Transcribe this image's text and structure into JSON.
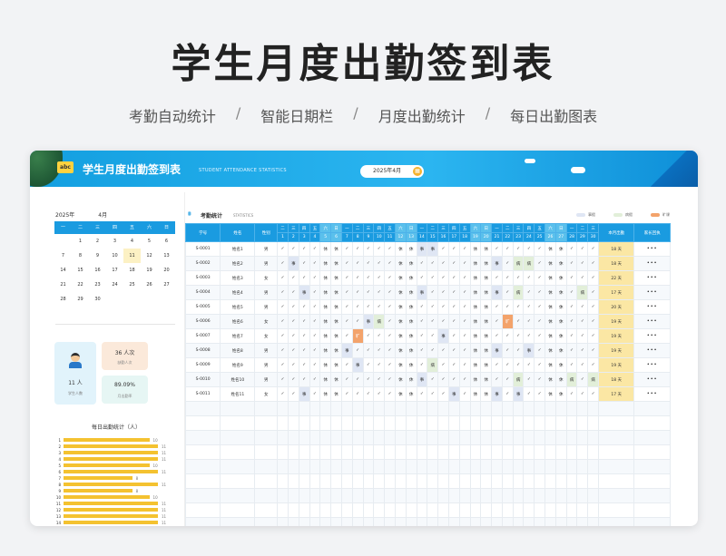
{
  "hero": {
    "title": "学生月度出勤签到表",
    "features": [
      "考勤自动统计",
      "智能日期栏",
      "月度出勤统计",
      "每日出勤图表"
    ],
    "separator": "/"
  },
  "banner": {
    "logo_text": "abc",
    "title": "学生月度出勤签到表",
    "subtitle": "STUDENT ATTENDANCE STATISTICS",
    "month_picker": "2025年4月",
    "calendar_icon": "calendar-icon"
  },
  "calendar": {
    "year": "2025年",
    "month": "4月",
    "weekdays": [
      "一",
      "二",
      "三",
      "四",
      "五",
      "六",
      "日"
    ],
    "today": "11",
    "weeks": [
      [
        "",
        "1",
        "2",
        "3",
        "4",
        "5",
        "6"
      ],
      [
        "7",
        "8",
        "9",
        "10",
        "11",
        "12",
        "13"
      ],
      [
        "14",
        "15",
        "16",
        "17",
        "18",
        "19",
        "20"
      ],
      [
        "21",
        "22",
        "23",
        "24",
        "25",
        "26",
        "27"
      ],
      [
        "28",
        "29",
        "30",
        "",
        "",
        "",
        ""
      ]
    ]
  },
  "cards": {
    "students": {
      "value": "11 人",
      "label": "学生人数"
    },
    "absent": {
      "value": "36 人次",
      "label": "缺勤人次"
    },
    "rate": {
      "value": "89.09%",
      "label": "月出勤率"
    }
  },
  "daily": {
    "title": "每日出勤统计（人）",
    "max": 11,
    "days": [
      {
        "d": "1",
        "v": 10
      },
      {
        "d": "2",
        "v": 11
      },
      {
        "d": "3",
        "v": 11
      },
      {
        "d": "4",
        "v": 11
      },
      {
        "d": "5",
        "v": 10
      },
      {
        "d": "6",
        "v": 11
      },
      {
        "d": "7",
        "v": 8
      },
      {
        "d": "8",
        "v": 11
      },
      {
        "d": "9",
        "v": 8
      },
      {
        "d": "10",
        "v": 10
      },
      {
        "d": "11",
        "v": 11
      },
      {
        "d": "12",
        "v": 11
      },
      {
        "d": "13",
        "v": 11
      },
      {
        "d": "14",
        "v": 11
      }
    ]
  },
  "stats": {
    "title": "考勤统计",
    "subtitle": "STATISTICS",
    "legend": [
      {
        "label": "事假",
        "color": "#dfe6f4"
      },
      {
        "label": "病假",
        "color": "#e2efd9"
      },
      {
        "label": "旷课",
        "color": "#f3a36b"
      }
    ]
  },
  "table": {
    "col_id": "学号",
    "col_name": "姓名",
    "col_gender": "性别",
    "col_total": "本月出勤",
    "col_parent": "家长回执",
    "weekday_row": [
      "二",
      "三",
      "四",
      "五",
      "六",
      "日",
      "一",
      "二",
      "三",
      "四",
      "五",
      "六",
      "日",
      "一",
      "二",
      "三",
      "四",
      "五",
      "六",
      "日",
      "一",
      "二",
      "三",
      "四",
      "五",
      "六",
      "日",
      "一",
      "二",
      "三"
    ],
    "weekend_index": [
      4,
      5,
      11,
      12,
      18,
      19,
      25,
      26
    ],
    "days": [
      "1",
      "2",
      "3",
      "4",
      "5",
      "6",
      "7",
      "8",
      "9",
      "10",
      "11",
      "12",
      "13",
      "14",
      "15",
      "16",
      "17",
      "18",
      "19",
      "20",
      "21",
      "22",
      "23",
      "24",
      "25",
      "26",
      "27",
      "28",
      "29",
      "30"
    ],
    "more": "•••",
    "rows": [
      {
        "id": "S-0001",
        "name": "姓名1",
        "gender": "男",
        "marks": [
          "✓",
          "✓",
          "✓",
          "✓",
          "休",
          "休",
          "✓",
          "✓",
          "✓",
          "✓",
          "✓",
          "休",
          "休",
          "事",
          "事",
          "✓",
          "✓",
          "✓",
          "休",
          "休",
          "✓",
          "✓",
          "✓",
          "✓",
          "✓",
          "休",
          "休",
          "✓",
          "✓",
          "✓"
        ],
        "total": "18 天"
      },
      {
        "id": "S-0002",
        "name": "姓名2",
        "gender": "男",
        "marks": [
          "✓",
          "事",
          "✓",
          "✓",
          "休",
          "休",
          "✓",
          "✓",
          "✓",
          "✓",
          "✓",
          "休",
          "休",
          "✓",
          "✓",
          "✓",
          "✓",
          "✓",
          "休",
          "休",
          "事",
          "✓",
          "病",
          "病",
          "✓",
          "休",
          "休",
          "✓",
          "✓",
          "✓"
        ],
        "total": "18 天"
      },
      {
        "id": "S-0003",
        "name": "姓名3",
        "gender": "女",
        "marks": [
          "✓",
          "✓",
          "✓",
          "✓",
          "休",
          "休",
          "✓",
          "✓",
          "✓",
          "✓",
          "✓",
          "休",
          "休",
          "✓",
          "✓",
          "✓",
          "✓",
          "✓",
          "休",
          "休",
          "✓",
          "✓",
          "✓",
          "✓",
          "✓",
          "休",
          "休",
          "✓",
          "✓",
          "✓"
        ],
        "total": "22 天"
      },
      {
        "id": "S-0004",
        "name": "姓名4",
        "gender": "男",
        "marks": [
          "✓",
          "✓",
          "事",
          "✓",
          "休",
          "休",
          "✓",
          "✓",
          "✓",
          "✓",
          "✓",
          "休",
          "休",
          "事",
          "✓",
          "✓",
          "✓",
          "✓",
          "休",
          "休",
          "事",
          "✓",
          "病",
          "✓",
          "✓",
          "休",
          "休",
          "✓",
          "病",
          "✓"
        ],
        "total": "17 天"
      },
      {
        "id": "S-0005",
        "name": "姓名5",
        "gender": "男",
        "marks": [
          "✓",
          "✓",
          "✓",
          "✓",
          "休",
          "休",
          "✓",
          "✓",
          "✓",
          "✓",
          "✓",
          "休",
          "休",
          "✓",
          "✓",
          "✓",
          "✓",
          "✓",
          "休",
          "休",
          "✓",
          "✓",
          "✓",
          "✓",
          "✓",
          "休",
          "休",
          "✓",
          "✓",
          "✓"
        ],
        "total": "20 天"
      },
      {
        "id": "S-0006",
        "name": "姓名6",
        "gender": "女",
        "marks": [
          "✓",
          "✓",
          "✓",
          "✓",
          "休",
          "休",
          "✓",
          "✓",
          "事",
          "病",
          "✓",
          "休",
          "休",
          "✓",
          "✓",
          "✓",
          "✓",
          "✓",
          "休",
          "休",
          "✓",
          "旷",
          "✓",
          "✓",
          "✓",
          "休",
          "休",
          "✓",
          "✓",
          "✓"
        ],
        "total": "19 天"
      },
      {
        "id": "S-0007",
        "name": "姓名7",
        "gender": "女",
        "marks": [
          "✓",
          "✓",
          "✓",
          "✓",
          "休",
          "休",
          "✓",
          "旷",
          "✓",
          "✓",
          "✓",
          "休",
          "休",
          "✓",
          "✓",
          "事",
          "✓",
          "✓",
          "休",
          "休",
          "✓",
          "✓",
          "✓",
          "✓",
          "✓",
          "休",
          "休",
          "✓",
          "✓",
          "✓"
        ],
        "total": "19 天"
      },
      {
        "id": "S-0008",
        "name": "姓名8",
        "gender": "男",
        "marks": [
          "✓",
          "✓",
          "✓",
          "✓",
          "休",
          "休",
          "事",
          "✓",
          "✓",
          "✓",
          "✓",
          "休",
          "休",
          "✓",
          "✓",
          "✓",
          "✓",
          "✓",
          "休",
          "休",
          "事",
          "✓",
          "✓",
          "事",
          "✓",
          "休",
          "休",
          "✓",
          "✓",
          "✓"
        ],
        "total": "19 天"
      },
      {
        "id": "S-0009",
        "name": "姓名9",
        "gender": "男",
        "marks": [
          "✓",
          "✓",
          "✓",
          "✓",
          "休",
          "休",
          "✓",
          "事",
          "✓",
          "✓",
          "✓",
          "休",
          "休",
          "✓",
          "病",
          "✓",
          "✓",
          "✓",
          "休",
          "休",
          "✓",
          "✓",
          "✓",
          "✓",
          "✓",
          "休",
          "休",
          "✓",
          "✓",
          "✓"
        ],
        "total": "19 天"
      },
      {
        "id": "S-0010",
        "name": "姓名10",
        "gender": "男",
        "marks": [
          "✓",
          "✓",
          "✓",
          "✓",
          "休",
          "休",
          "✓",
          "✓",
          "✓",
          "✓",
          "✓",
          "休",
          "休",
          "事",
          "✓",
          "✓",
          "✓",
          "✓",
          "休",
          "休",
          "✓",
          "✓",
          "病",
          "✓",
          "✓",
          "休",
          "休",
          "病",
          "✓",
          "病"
        ],
        "total": "18 天"
      },
      {
        "id": "S-0011",
        "name": "姓名11",
        "gender": "女",
        "marks": [
          "✓",
          "✓",
          "事",
          "✓",
          "休",
          "休",
          "✓",
          "✓",
          "✓",
          "✓",
          "✓",
          "休",
          "休",
          "✓",
          "✓",
          "✓",
          "事",
          "✓",
          "休",
          "休",
          "事",
          "✓",
          "事",
          "✓",
          "✓",
          "休",
          "休",
          "✓",
          "✓",
          "✓"
        ],
        "total": "17 天"
      }
    ],
    "empty_rows": 9
  }
}
